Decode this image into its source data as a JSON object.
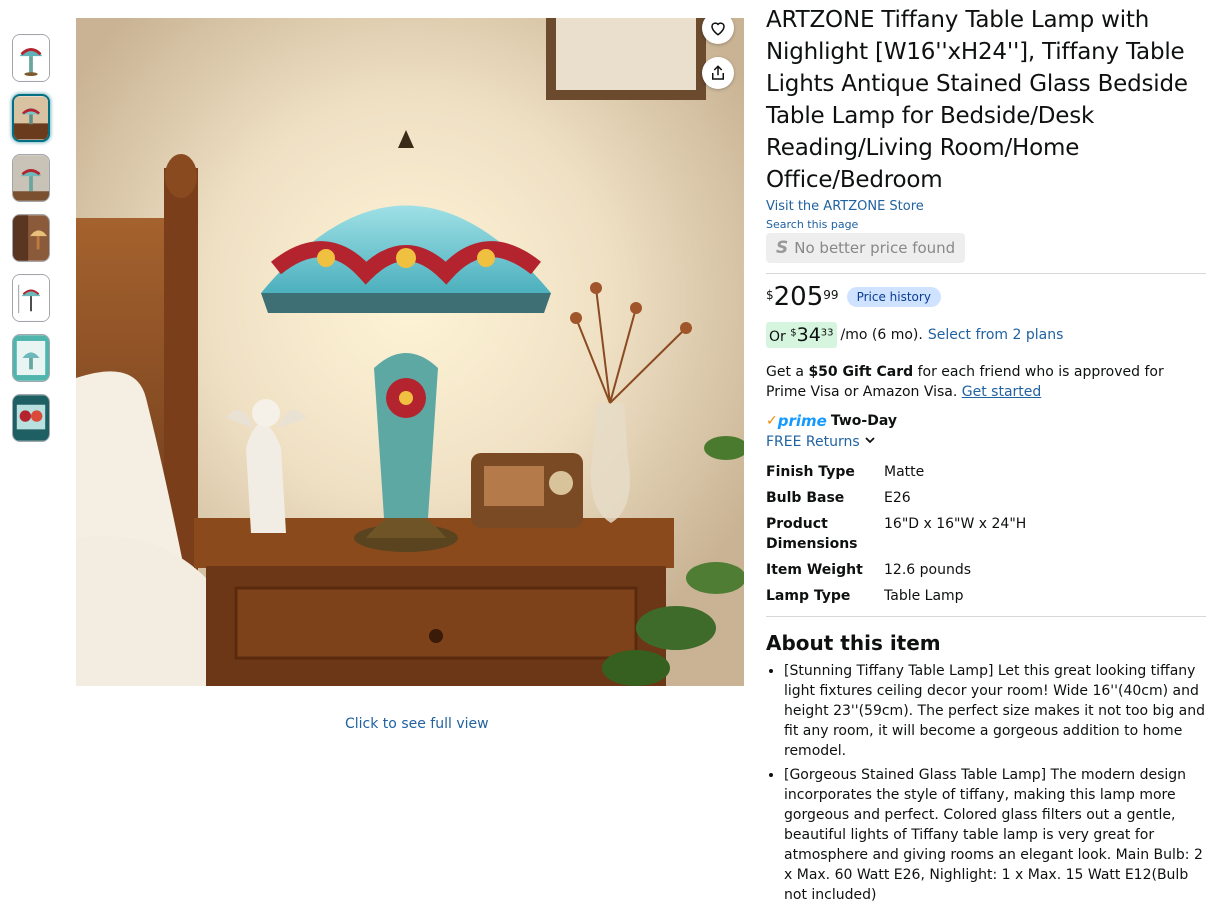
{
  "gallery": {
    "thumbnail_count": 7,
    "active_index": 1,
    "full_view_label": "Click to see full view"
  },
  "product": {
    "title": "ARTZONE Tiffany Table Lamp with Nighlight [W16''xH24''], Tiffany Table Lights Antique Stained Glass Bedside Table Lamp for Bedside/Desk Reading/Living Room/Home Office/Bedroom",
    "store_link": "Visit the ARTZONE Store",
    "search_page": "Search this page",
    "no_better_price": "No better price found",
    "price_symbol": "$",
    "price_whole": "205",
    "price_fraction": "99",
    "price_history_label": "Price history",
    "monthly_prefix": "Or",
    "monthly_symbol": "$",
    "monthly_whole": "34",
    "monthly_fraction": "33",
    "monthly_suffix": "/mo (6 mo).",
    "monthly_plans_link": "Select from 2 plans",
    "gift_prefix": "Get a",
    "gift_bold": "$50 Gift Card",
    "gift_text": "for each friend who is approved for Prime Visa or Amazon Visa.",
    "gift_link": "Get started",
    "prime_word": "prime",
    "prime_delivery": "Two-Day",
    "free_returns": "FREE Returns"
  },
  "specs": [
    {
      "key": "Finish Type",
      "value": "Matte"
    },
    {
      "key": "Bulb Base",
      "value": "E26"
    },
    {
      "key": "Product Dimensions",
      "value": "16\"D x 16\"W x 24\"H"
    },
    {
      "key": "Item Weight",
      "value": "12.6 pounds"
    },
    {
      "key": "Lamp Type",
      "value": "Table Lamp"
    }
  ],
  "about": {
    "heading": "About this item",
    "bullets": [
      "[Stunning Tiffany Table Lamp] Let this great looking tiffany light fixtures ceiling decor your room! Wide 16''(40cm) and height 23''(59cm). The perfect size makes it not too big and fit any room, it will become a gorgeous addition to home remodel.",
      "[Gorgeous Stained Glass Table Lamp] The modern design incorporates the style of tiffany, making this lamp more gorgeous and perfect. Colored glass filters out a gentle, beautiful lights of Tiffany table lamp is very great for atmosphere and giving rooms an elegant look. Main Bulb: 2 x Max. 60 Watt E26, Nighlight: 1 x Max. 15 Watt E12(Bulb not included)"
    ]
  },
  "icons": {
    "wishlist": "heart-icon",
    "share": "share-icon",
    "returns_toggle": "chevron-down-icon",
    "prime_check": "check-icon"
  }
}
